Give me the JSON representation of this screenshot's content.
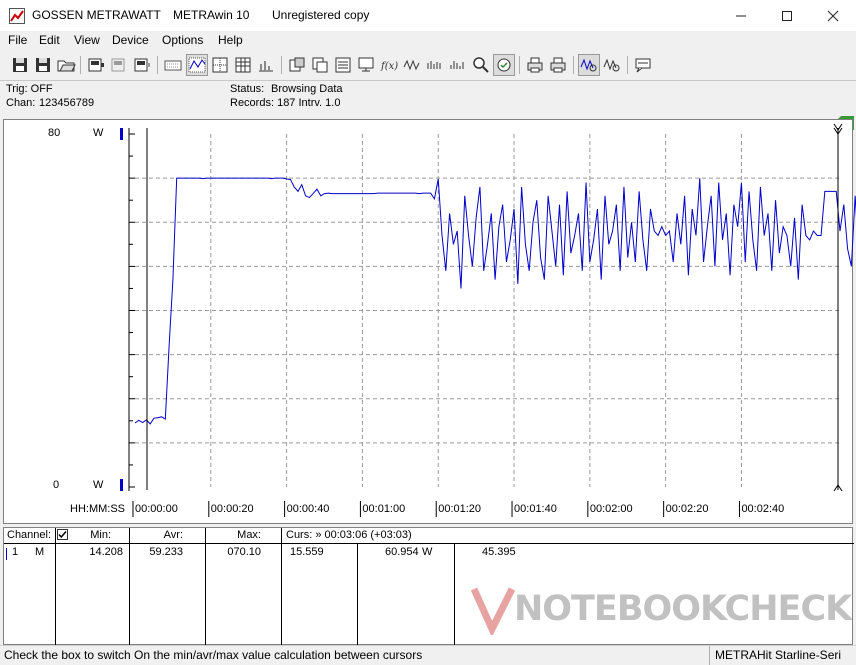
{
  "window": {
    "brand": "GOSSEN METRAWATT",
    "app": "METRAwin 10",
    "license": "Unregistered copy"
  },
  "menu": [
    "File",
    "Edit",
    "View",
    "Device",
    "Options",
    "Help"
  ],
  "info": {
    "trig": "Trig: OFF",
    "chan_label": "Chan:",
    "chan_value": "123456789",
    "status_label": "Status:",
    "status_value": "Browsing Data",
    "records": "Records: 187  Intrv. 1.0"
  },
  "chart": {
    "y_top": "80",
    "y_bottom": "0",
    "unit": "W",
    "time_label": "HH:MM:SS"
  },
  "chart_data": {
    "type": "line",
    "ylim": [
      0,
      80
    ],
    "xlim": [
      0,
      186
    ],
    "x_tick_labels": [
      "00:00:00",
      "00:00:20",
      "00:00:40",
      "00:01:00",
      "00:01:20",
      "00:01:40",
      "00:02:00",
      "00:02:20",
      "00:02:40"
    ],
    "x_tick_values": [
      0,
      20,
      40,
      60,
      80,
      100,
      120,
      140,
      160
    ],
    "y_unit": "W",
    "grid": true,
    "series": [
      {
        "color": "#0000cc",
        "values": [
          14.5,
          15.1,
          14.6,
          15.2,
          14.3,
          15.6,
          15.7,
          15.9,
          15.4,
          32,
          47,
          70,
          70,
          70,
          70,
          70,
          70,
          70,
          69.9,
          70,
          70,
          70,
          70,
          70,
          70,
          70,
          70,
          70,
          70,
          70,
          70,
          70,
          70,
          70,
          70,
          70,
          69.9,
          70,
          70,
          70,
          69.8,
          69.7,
          68,
          67,
          68.5,
          66,
          65.6,
          66.5,
          67.5,
          66,
          66.5,
          66.6,
          66.5,
          66.5,
          66.5,
          66.5,
          66.5,
          66.5,
          66.5,
          66.5,
          66.5,
          66.5,
          66.5,
          66.5,
          66.6,
          66.6,
          66.6,
          66.6,
          66.6,
          66.6,
          66.6,
          66.6,
          66.6,
          66.6,
          66.6,
          66.5,
          66.6,
          66.6,
          66.6,
          65.3,
          69.8,
          57,
          49,
          62,
          55,
          58,
          45,
          66,
          57,
          50,
          61,
          68,
          49,
          55,
          62,
          47,
          59,
          64,
          51,
          56,
          63,
          46,
          68,
          55,
          49,
          60,
          65,
          52,
          47,
          66,
          58,
          50,
          64,
          48,
          67,
          53,
          57,
          62,
          49,
          69,
          51,
          56,
          63,
          47,
          66,
          55,
          58,
          64,
          49,
          68,
          52,
          60,
          51,
          67,
          56,
          49,
          63,
          58,
          57,
          59,
          57,
          58,
          51,
          62,
          55,
          66,
          48,
          63,
          57,
          70,
          51,
          59,
          66,
          50,
          69,
          56,
          62,
          48,
          64,
          59,
          69,
          51,
          67,
          56,
          49,
          68,
          57,
          62,
          49,
          65,
          53,
          59,
          57,
          50,
          61,
          47,
          64,
          57,
          56,
          58,
          57,
          57,
          67,
          67,
          67,
          67,
          58,
          64,
          54,
          50,
          66,
          52,
          67,
          49,
          69,
          61.4
        ]
      }
    ]
  },
  "table": {
    "headers": {
      "channel": "Channel:",
      "min": "Min:",
      "avr": "Avr:",
      "max": "Max:",
      "curs": "Curs: » 00:03:06 (+03:03)"
    },
    "row": {
      "ch": "1",
      "mode": "M",
      "min": "14.208",
      "avr": "59.233",
      "max": "070.10",
      "c1": "15.559",
      "c2": "60.954",
      "unit": "W",
      "c3": "45.395"
    }
  },
  "status": {
    "hint": "Check the box to switch On the min/avr/max value calculation between cursors",
    "device": "METRAHit Starline-Seri"
  },
  "watermark": "NOTEBOOKCHECK",
  "colors": {
    "trace": "#0000cc",
    "grid": "#9a9a9a",
    "accent": "#2e8b2e"
  }
}
